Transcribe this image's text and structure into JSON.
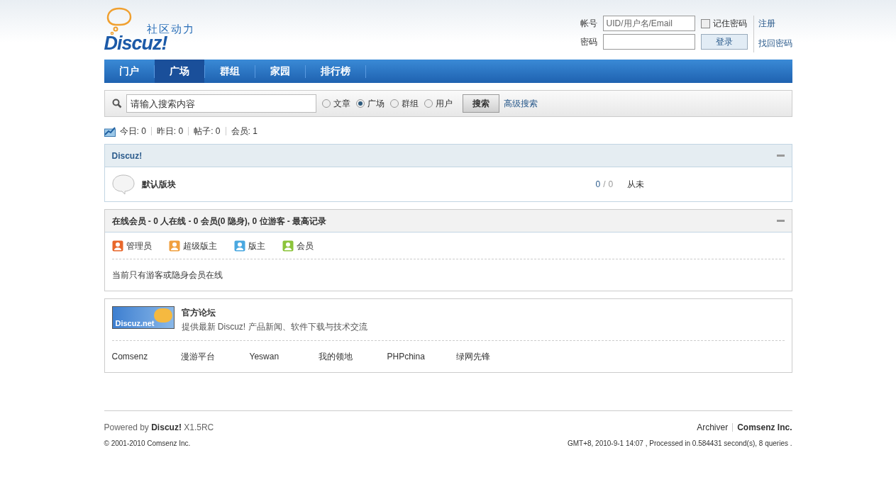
{
  "logo": {
    "tagline": "社区动力",
    "wordmark": "Discuz!"
  },
  "login": {
    "account_label": "帐号",
    "account_placeholder": "UID/用户名/Email",
    "remember": {
      "label": "记住密码",
      "checked": false
    },
    "password_label": "密码",
    "submit": "登录",
    "links": [
      "注册",
      "找回密码"
    ]
  },
  "nav": [
    {
      "label": "门户",
      "selected": false
    },
    {
      "label": "广场",
      "selected": true
    },
    {
      "label": "群组",
      "selected": false
    },
    {
      "label": "家园",
      "selected": false
    },
    {
      "label": "排行榜",
      "selected": false
    }
  ],
  "search": {
    "placeholder": "请输入搜索内容",
    "options": [
      {
        "label": "文章",
        "selected": false
      },
      {
        "label": "广场",
        "selected": true
      },
      {
        "label": "群组",
        "selected": false
      },
      {
        "label": "用户",
        "selected": false
      }
    ],
    "button": "搜索",
    "advanced": "高级搜索"
  },
  "stats": [
    "今日: 0",
    "昨日: 0",
    "帖子: 0",
    "会员: 1"
  ],
  "category": {
    "title": "Discuz!",
    "forums": [
      {
        "name": "默认版块",
        "threads": "0",
        "separator": "/",
        "posts": "0",
        "last_post": "从未"
      }
    ]
  },
  "online": {
    "title": "在线会员 - 0 人在线 - 0 会员(0 隐身), 0 位游客 - 最高记录",
    "legend": [
      {
        "label": "管理员",
        "color": "#e8682c"
      },
      {
        "label": "超级版主",
        "color": "#f0a040"
      },
      {
        "label": "版主",
        "color": "#4aa8e0"
      },
      {
        "label": "会员",
        "color": "#8cc43c"
      }
    ],
    "note": "当前只有游客或隐身会员在线"
  },
  "links": {
    "badge": "Discuz.net",
    "title": "官方论坛",
    "description": "提供最新 Discuz! 产品新闻、软件下载与技术交流",
    "items": [
      "Comsenz",
      "漫游平台",
      "Yeswan",
      "我的领地",
      "PHPchina",
      "绿网先锋"
    ]
  },
  "footer": {
    "powered": "Powered by **Discuz!** X1.5RC",
    "copyright": "© 2001-2010 Comsenz Inc.",
    "links": [
      "Archiver",
      "Comsenz Inc."
    ],
    "processed": "GMT+8, 2010-9-1 14:07 , Processed in 0.584431 second(s), 8 queries ."
  }
}
